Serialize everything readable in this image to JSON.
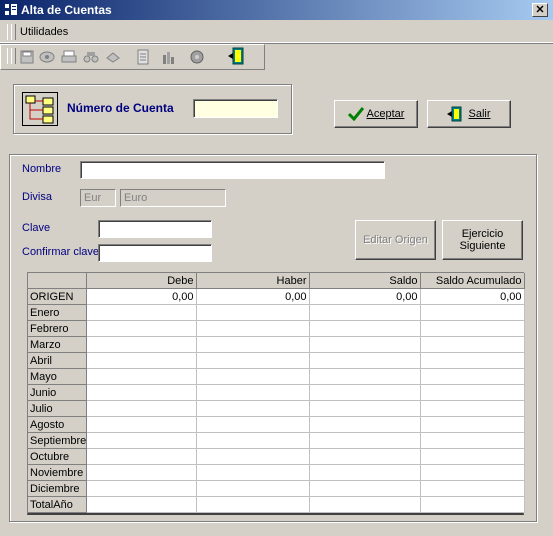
{
  "window": {
    "title": "Alta de Cuentas",
    "close_glyph": "✕"
  },
  "menu": {
    "items": [
      {
        "label": "Utilidades"
      }
    ]
  },
  "toolbar": {
    "icons": [
      "save-icon",
      "preview-icon",
      "print-icon",
      "search-icon",
      "refresh-icon",
      "document-icon",
      "chart-icon",
      "settings-icon",
      "exit-door-icon"
    ]
  },
  "account": {
    "label": "Número de Cuenta",
    "value": ""
  },
  "buttons": {
    "accept": "Aceptar",
    "exit": "Salir",
    "edit_origin": "Editar Origen",
    "next_year": "Ejercicio Siguiente"
  },
  "form": {
    "nombre_label": "Nombre",
    "nombre_value": "",
    "divisa_label": "Divisa",
    "divisa_code": "Eur",
    "divisa_name": "Euro",
    "clave_label": "Clave",
    "clave_value": "",
    "confirmar_label": "Confirmar clave",
    "confirmar_value": ""
  },
  "table": {
    "columns": [
      "",
      "Debe",
      "Haber",
      "Saldo",
      "Saldo Acumulado"
    ],
    "rows": [
      {
        "label": "ORIGEN",
        "debe": "0,00",
        "haber": "0,00",
        "saldo": "0,00",
        "acum": "0,00"
      },
      {
        "label": "Enero",
        "debe": "",
        "haber": "",
        "saldo": "",
        "acum": ""
      },
      {
        "label": "Febrero",
        "debe": "",
        "haber": "",
        "saldo": "",
        "acum": ""
      },
      {
        "label": "Marzo",
        "debe": "",
        "haber": "",
        "saldo": "",
        "acum": ""
      },
      {
        "label": "Abril",
        "debe": "",
        "haber": "",
        "saldo": "",
        "acum": ""
      },
      {
        "label": "Mayo",
        "debe": "",
        "haber": "",
        "saldo": "",
        "acum": ""
      },
      {
        "label": "Junio",
        "debe": "",
        "haber": "",
        "saldo": "",
        "acum": ""
      },
      {
        "label": "Julio",
        "debe": "",
        "haber": "",
        "saldo": "",
        "acum": ""
      },
      {
        "label": "Agosto",
        "debe": "",
        "haber": "",
        "saldo": "",
        "acum": ""
      },
      {
        "label": "Septiembre",
        "debe": "",
        "haber": "",
        "saldo": "",
        "acum": ""
      },
      {
        "label": "Octubre",
        "debe": "",
        "haber": "",
        "saldo": "",
        "acum": ""
      },
      {
        "label": "Noviembre",
        "debe": "",
        "haber": "",
        "saldo": "",
        "acum": ""
      },
      {
        "label": "Diciembre",
        "debe": "",
        "haber": "",
        "saldo": "",
        "acum": ""
      },
      {
        "label": "TotalAño",
        "debe": "",
        "haber": "",
        "saldo": "",
        "acum": ""
      }
    ]
  }
}
